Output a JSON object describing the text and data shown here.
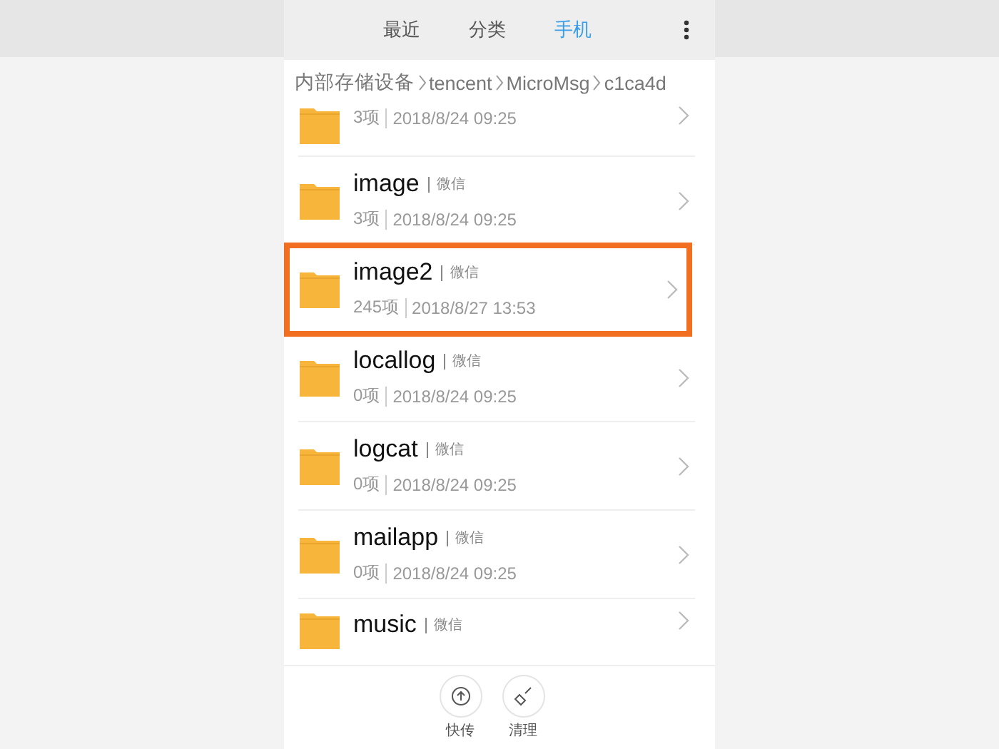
{
  "tabs": [
    {
      "label": "最近",
      "selected": false
    },
    {
      "label": "分类",
      "selected": false
    },
    {
      "label": "手机",
      "selected": true
    }
  ],
  "breadcrumb": [
    "内部存储设备",
    "tencent",
    "MicroMsg",
    "c1ca4d"
  ],
  "folders": [
    {
      "count": "3项",
      "date": "2018/8/24 09:25",
      "highlighted": false
    },
    {
      "name": "image",
      "tag": "微信",
      "count": "3项",
      "date": "2018/8/24 09:25",
      "highlighted": false
    },
    {
      "name": "image2",
      "tag": "微信",
      "count": "245项",
      "date": "2018/8/27 13:53",
      "highlighted": true
    },
    {
      "name": "locallog",
      "tag": "微信",
      "count": "0项",
      "date": "2018/8/24 09:25",
      "highlighted": false
    },
    {
      "name": "logcat",
      "tag": "微信",
      "count": "0项",
      "date": "2018/8/24 09:25",
      "highlighted": false
    },
    {
      "name": "mailapp",
      "tag": "微信",
      "count": "0项",
      "date": "2018/8/24 09:25",
      "highlighted": false
    },
    {
      "name": "music",
      "tag": "微信",
      "highlighted": false
    }
  ],
  "actions": [
    {
      "kind": "transfer",
      "label": "快传"
    },
    {
      "kind": "clean",
      "label": "清理"
    }
  ]
}
